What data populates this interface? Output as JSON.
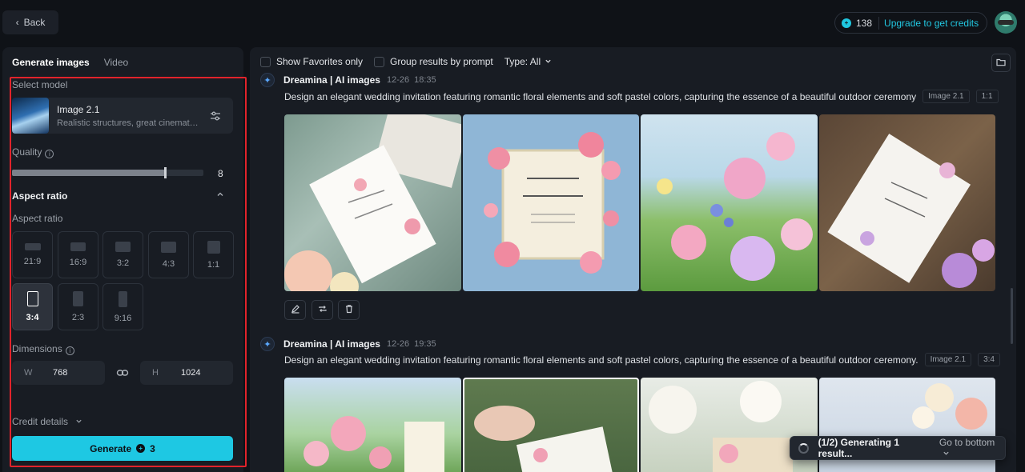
{
  "header": {
    "back_label": "Back",
    "credits": "138",
    "upgrade_label": "Upgrade to get credits"
  },
  "left": {
    "tabs": [
      {
        "label": "Generate images",
        "active": true
      },
      {
        "label": "Video",
        "active": false
      }
    ],
    "select_model_label": "Select model",
    "model": {
      "name": "Image 2.1",
      "description": "Realistic structures, great cinematog..."
    },
    "quality_label": "Quality",
    "quality_value": "8",
    "quality_fraction": 0.8,
    "aspect_section_title": "Aspect ratio",
    "aspect_label": "Aspect ratio",
    "ratios": [
      {
        "label": "21:9",
        "selected": false
      },
      {
        "label": "16:9",
        "selected": false
      },
      {
        "label": "3:2",
        "selected": false
      },
      {
        "label": "4:3",
        "selected": false
      },
      {
        "label": "1:1",
        "selected": false
      },
      {
        "label": "3:4",
        "selected": true
      },
      {
        "label": "2:3",
        "selected": false
      },
      {
        "label": "9:16",
        "selected": false
      }
    ],
    "dimensions_label": "Dimensions",
    "width_axis": "W",
    "width_value": "768",
    "height_axis": "H",
    "height_value": "1024",
    "credit_details_label": "Credit details",
    "generate_label": "Generate",
    "generate_cost": "3"
  },
  "filters": {
    "favorites_label": "Show Favorites only",
    "group_label": "Group results by prompt",
    "type_label": "Type: All"
  },
  "entries": [
    {
      "name": "Dreamina | AI images",
      "date": "12-26",
      "time": "18:35",
      "prompt": "Design an elegant wedding invitation featuring romantic floral elements and soft pastel colors, capturing the essence of a beautiful outdoor ceremony",
      "model_tag": "Image 2.1",
      "ratio_tag": "1:1"
    },
    {
      "name": "Dreamina | AI images",
      "date": "12-26",
      "time": "19:35",
      "prompt": "Design an elegant wedding invitation featuring romantic floral elements and soft pastel colors, capturing the essence of a beautiful outdoor ceremony.",
      "model_tag": "Image 2.1",
      "ratio_tag": "3:4"
    }
  ],
  "toast": {
    "status": "(1/2) Generating 1 result...",
    "link": "Go to bottom"
  },
  "colors": {
    "accent": "#1ec8e3",
    "highlight_frame": "#e1232b",
    "background": "#0f1217",
    "panel": "#181c23"
  }
}
